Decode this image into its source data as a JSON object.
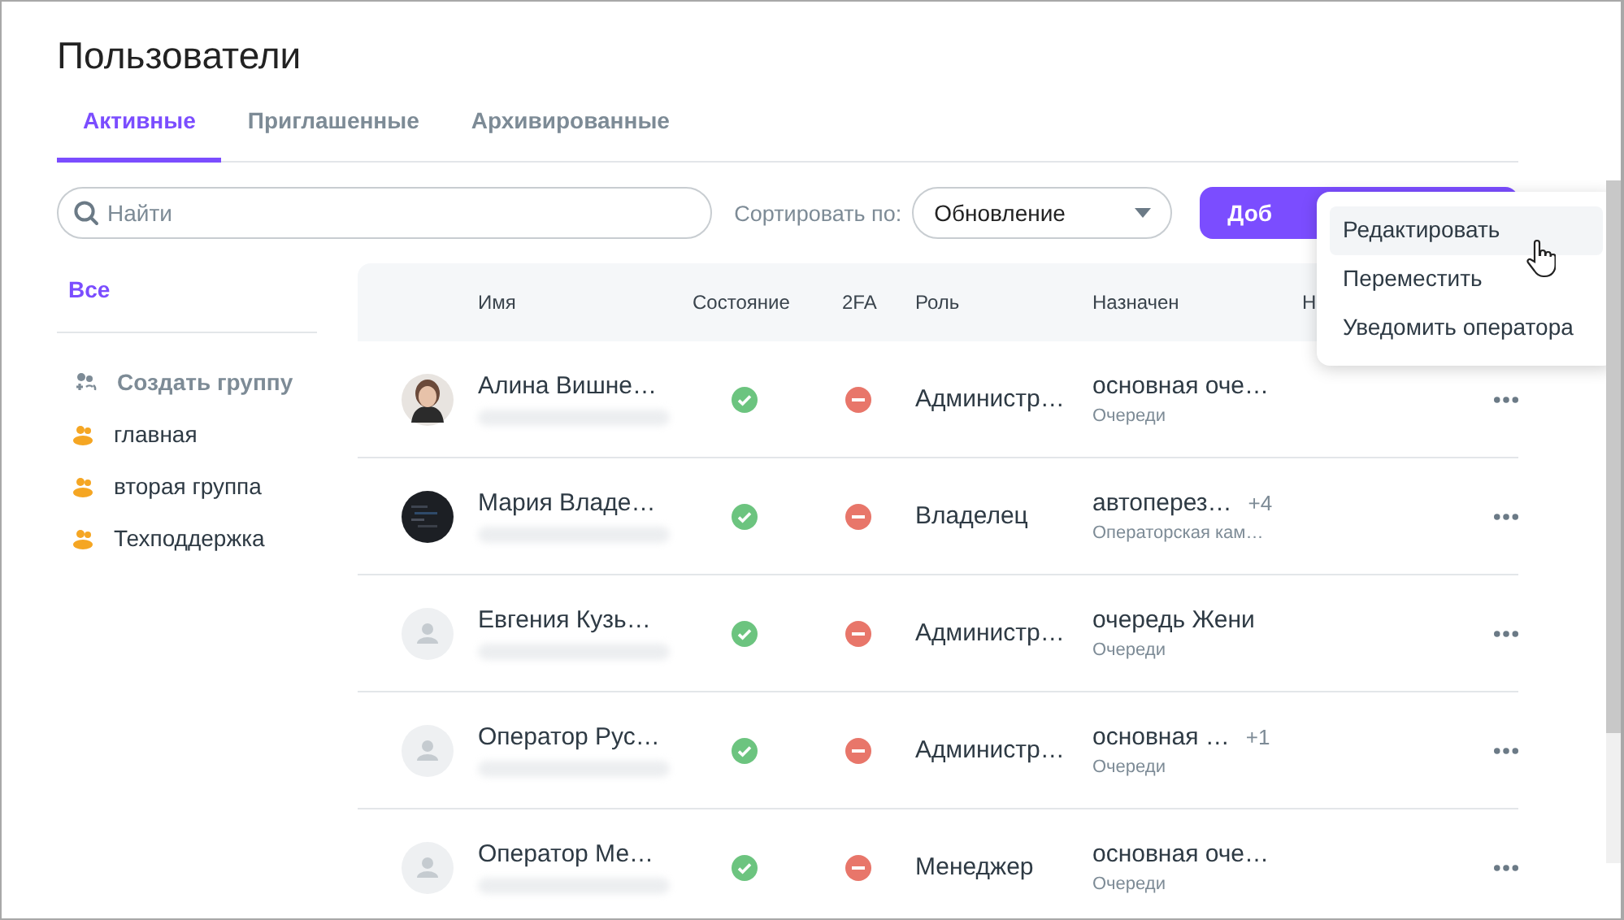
{
  "title": "Пользователи",
  "tabs": [
    {
      "label": "Активные",
      "selected": true
    },
    {
      "label": "Приглашенные",
      "selected": false
    },
    {
      "label": "Архивированные",
      "selected": false
    }
  ],
  "search": {
    "placeholder": "Найти"
  },
  "sort": {
    "label": "Сортировать по:",
    "value": "Обновление"
  },
  "add_button": {
    "label": "Доб"
  },
  "sidebar": {
    "all": {
      "label": "Все",
      "selected": true
    },
    "create": "Создать группу",
    "groups": [
      {
        "label": "главная"
      },
      {
        "label": "вторая группа"
      },
      {
        "label": "Техподдержка"
      }
    ]
  },
  "table": {
    "columns": [
      "Имя",
      "Состояние",
      "2FA",
      "Роль",
      "Назначен",
      "Н"
    ],
    "rows": [
      {
        "kind": "person",
        "name": "Алина Вишне…",
        "active": true,
        "twofa": false,
        "role": "Администр…",
        "assigned": "основная оче…",
        "group": "Очереди"
      },
      {
        "kind": "picture",
        "name": "Мария Владе…",
        "active": true,
        "twofa": false,
        "role": "Владелец",
        "assigned": "автоперез…",
        "extra": "+4",
        "group": "Операторская кам…"
      },
      {
        "kind": "default",
        "name": "Евгения Кузь…",
        "active": true,
        "twofa": false,
        "role": "Администр…",
        "assigned": "очередь Жени",
        "group": "Очереди"
      },
      {
        "kind": "default",
        "name": "Оператор Рус…",
        "active": true,
        "twofa": false,
        "role": "Администр…",
        "assigned": "основная …",
        "extra": "+1",
        "group": "Очереди"
      },
      {
        "kind": "default",
        "name": "Оператор Ме…",
        "active": true,
        "twofa": false,
        "role": "Менеджер",
        "assigned": "основная оче…",
        "group": "Очереди"
      }
    ]
  },
  "menu": [
    {
      "label": "Редактировать",
      "selected": true
    },
    {
      "label": "Переместить",
      "selected": false
    },
    {
      "label": "Уведомить оператора",
      "selected": false
    }
  ]
}
